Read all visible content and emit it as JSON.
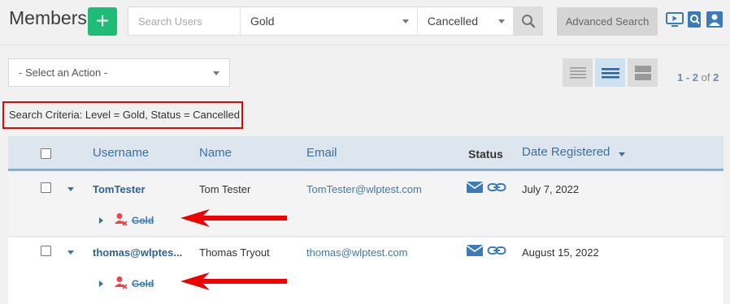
{
  "header": {
    "title": "Members",
    "add_label": "+",
    "search_placeholder": "Search Users",
    "level_value": "Gold",
    "status_value": "Cancelled",
    "advanced_search": "Advanced Search"
  },
  "actions": {
    "select_label": "- Select an Action -"
  },
  "pager": {
    "range": "1 - 2",
    "of_label": "of",
    "total": "2"
  },
  "criteria": "Search Criteria: Level = Gold, Status = Cancelled",
  "table": {
    "columns": [
      "Username",
      "Name",
      "Email",
      "Status",
      "Date Registered"
    ],
    "rows": [
      {
        "username": "TomTester",
        "name": "Tom Tester",
        "email": "TomTester@wlptest.com",
        "date": "July 7, 2022",
        "level": "Gold"
      },
      {
        "username": "thomas@wlptes...",
        "name": "Thomas Tryout",
        "email": "thomas@wlptest.com",
        "date": "August 15, 2022",
        "level": "Gold"
      }
    ]
  },
  "colors": {
    "add_green": "#1ebc77",
    "link_blue": "#3f7ab0",
    "highlight_red": "#ee0000"
  },
  "icons": [
    "plus-icon",
    "search-icon",
    "video-icon",
    "search-doc-icon",
    "user-card-icon",
    "list-view-icon",
    "compact-view-icon",
    "grid-view-icon",
    "envelope-icon",
    "link-icon",
    "user-cancelled-icon",
    "red-arrow-icon"
  ]
}
